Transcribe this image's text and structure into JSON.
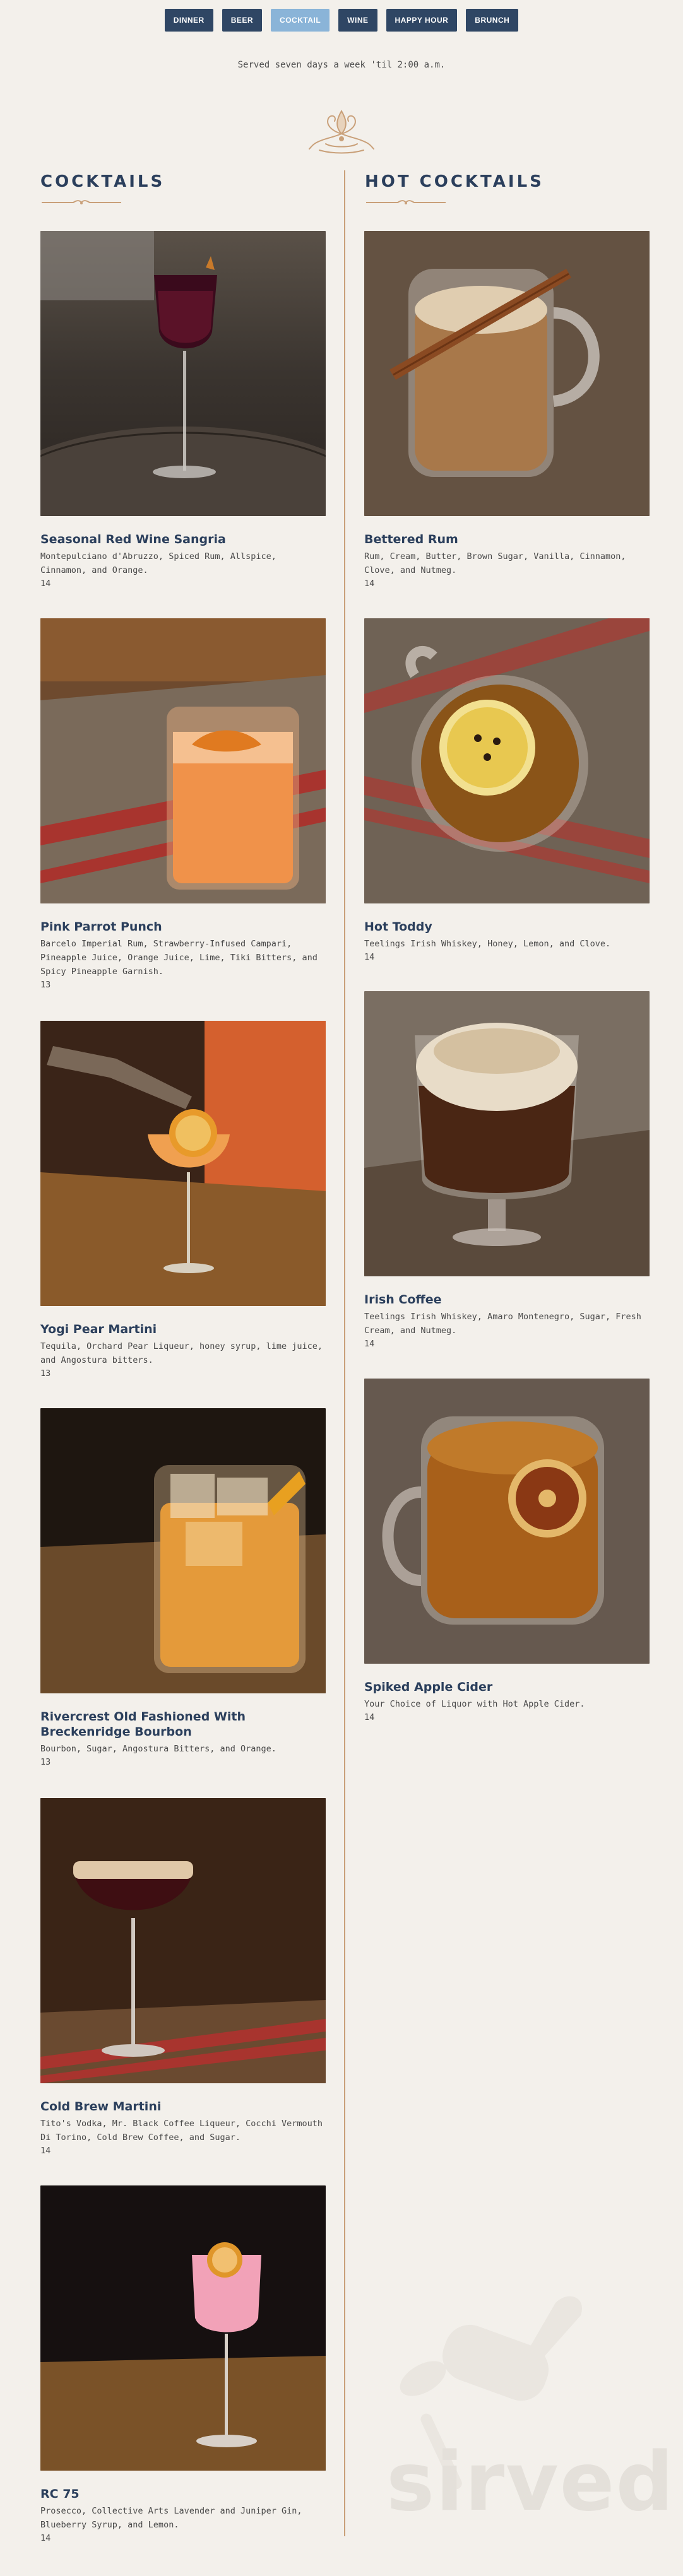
{
  "nav": {
    "tabs": [
      {
        "label": "DINNER"
      },
      {
        "label": "BEER"
      },
      {
        "label": "COCKTAIL"
      },
      {
        "label": "WINE"
      },
      {
        "label": "HAPPY HOUR"
      },
      {
        "label": "BRUNCH"
      }
    ],
    "active_tab": "COCKTAIL"
  },
  "subtitle": "Served seven days a week 'til 2:00 a.m.",
  "sections": [
    {
      "title": "COCKTAILS",
      "items": [
        {
          "name": "Seasonal Red Wine Sangria",
          "description": "Montepulciano d'Abruzzo, Spiced Rum, Allspice, Cinnamon, and Orange.",
          "price": "14",
          "image": "red-wine-sangria-glass-photo"
        },
        {
          "name": "Pink Parrot Punch",
          "description": "Barcelo Imperial Rum, Strawberry-Infused Campari, Pineapple Juice, Orange Juice, Lime, Tiki Bitters, and Spicy Pineapple Garnish.",
          "price": "13",
          "image": "orange-punch-rocks-glass-photo"
        },
        {
          "name": "Yogi Pear Martini",
          "description": "Tequila, Orchard Pear Liqueur, honey syrup, lime juice, and Angostura bitters.",
          "price": "13",
          "image": "pear-martini-garnish-photo"
        },
        {
          "name": "Rivercrest Old Fashioned With Breckenridge Bourbon",
          "description": "Bourbon, Sugar, Angostura Bitters, and Orange.",
          "price": "13",
          "image": "old-fashioned-ice-glass-photo"
        },
        {
          "name": "Cold Brew Martini",
          "description": "Tito's Vodka, Mr. Black Coffee Liqueur, Cocchi Vermouth Di Torino, Cold Brew Coffee, and Sugar.",
          "price": "14",
          "image": "coffee-martini-photo"
        },
        {
          "name": "RC 75",
          "description": "Prosecco, Collective Arts Lavender and Juniper Gin, Blueberry Syrup, and Lemon.",
          "price": "14",
          "image": "pink-wine-glass-cocktail-photo"
        }
      ]
    },
    {
      "title": "HOT COCKTAILS",
      "items": [
        {
          "name": "Bettered Rum",
          "description": "Rum, Cream, Butter, Brown Sugar, Vanilla, Cinnamon, Clove, and Nutmeg.",
          "price": "14",
          "image": "hot-buttered-rum-mug-photo"
        },
        {
          "name": "Hot Toddy",
          "description": "Teelings Irish Whiskey, Honey, Lemon, and Clove.",
          "price": "14",
          "image": "hot-toddy-lemon-mug-photo"
        },
        {
          "name": "Irish Coffee",
          "description": "Teelings Irish Whiskey, Amaro Montenegro, Sugar, Fresh Cream, and Nutmeg.",
          "price": "14",
          "image": "irish-coffee-glass-photo"
        },
        {
          "name": "Spiked Apple Cider",
          "description": "Your Choice of Liquor with Hot Apple Cider.",
          "price": "14",
          "image": "apple-cider-mug-photo"
        }
      ]
    }
  ],
  "watermark": "sirved",
  "colors": {
    "background": "#f3f0eb",
    "tab": "#2f4664",
    "tab_active": "#8ab4d8",
    "heading": "#2b3f5c",
    "accent": "#c9a079"
  }
}
